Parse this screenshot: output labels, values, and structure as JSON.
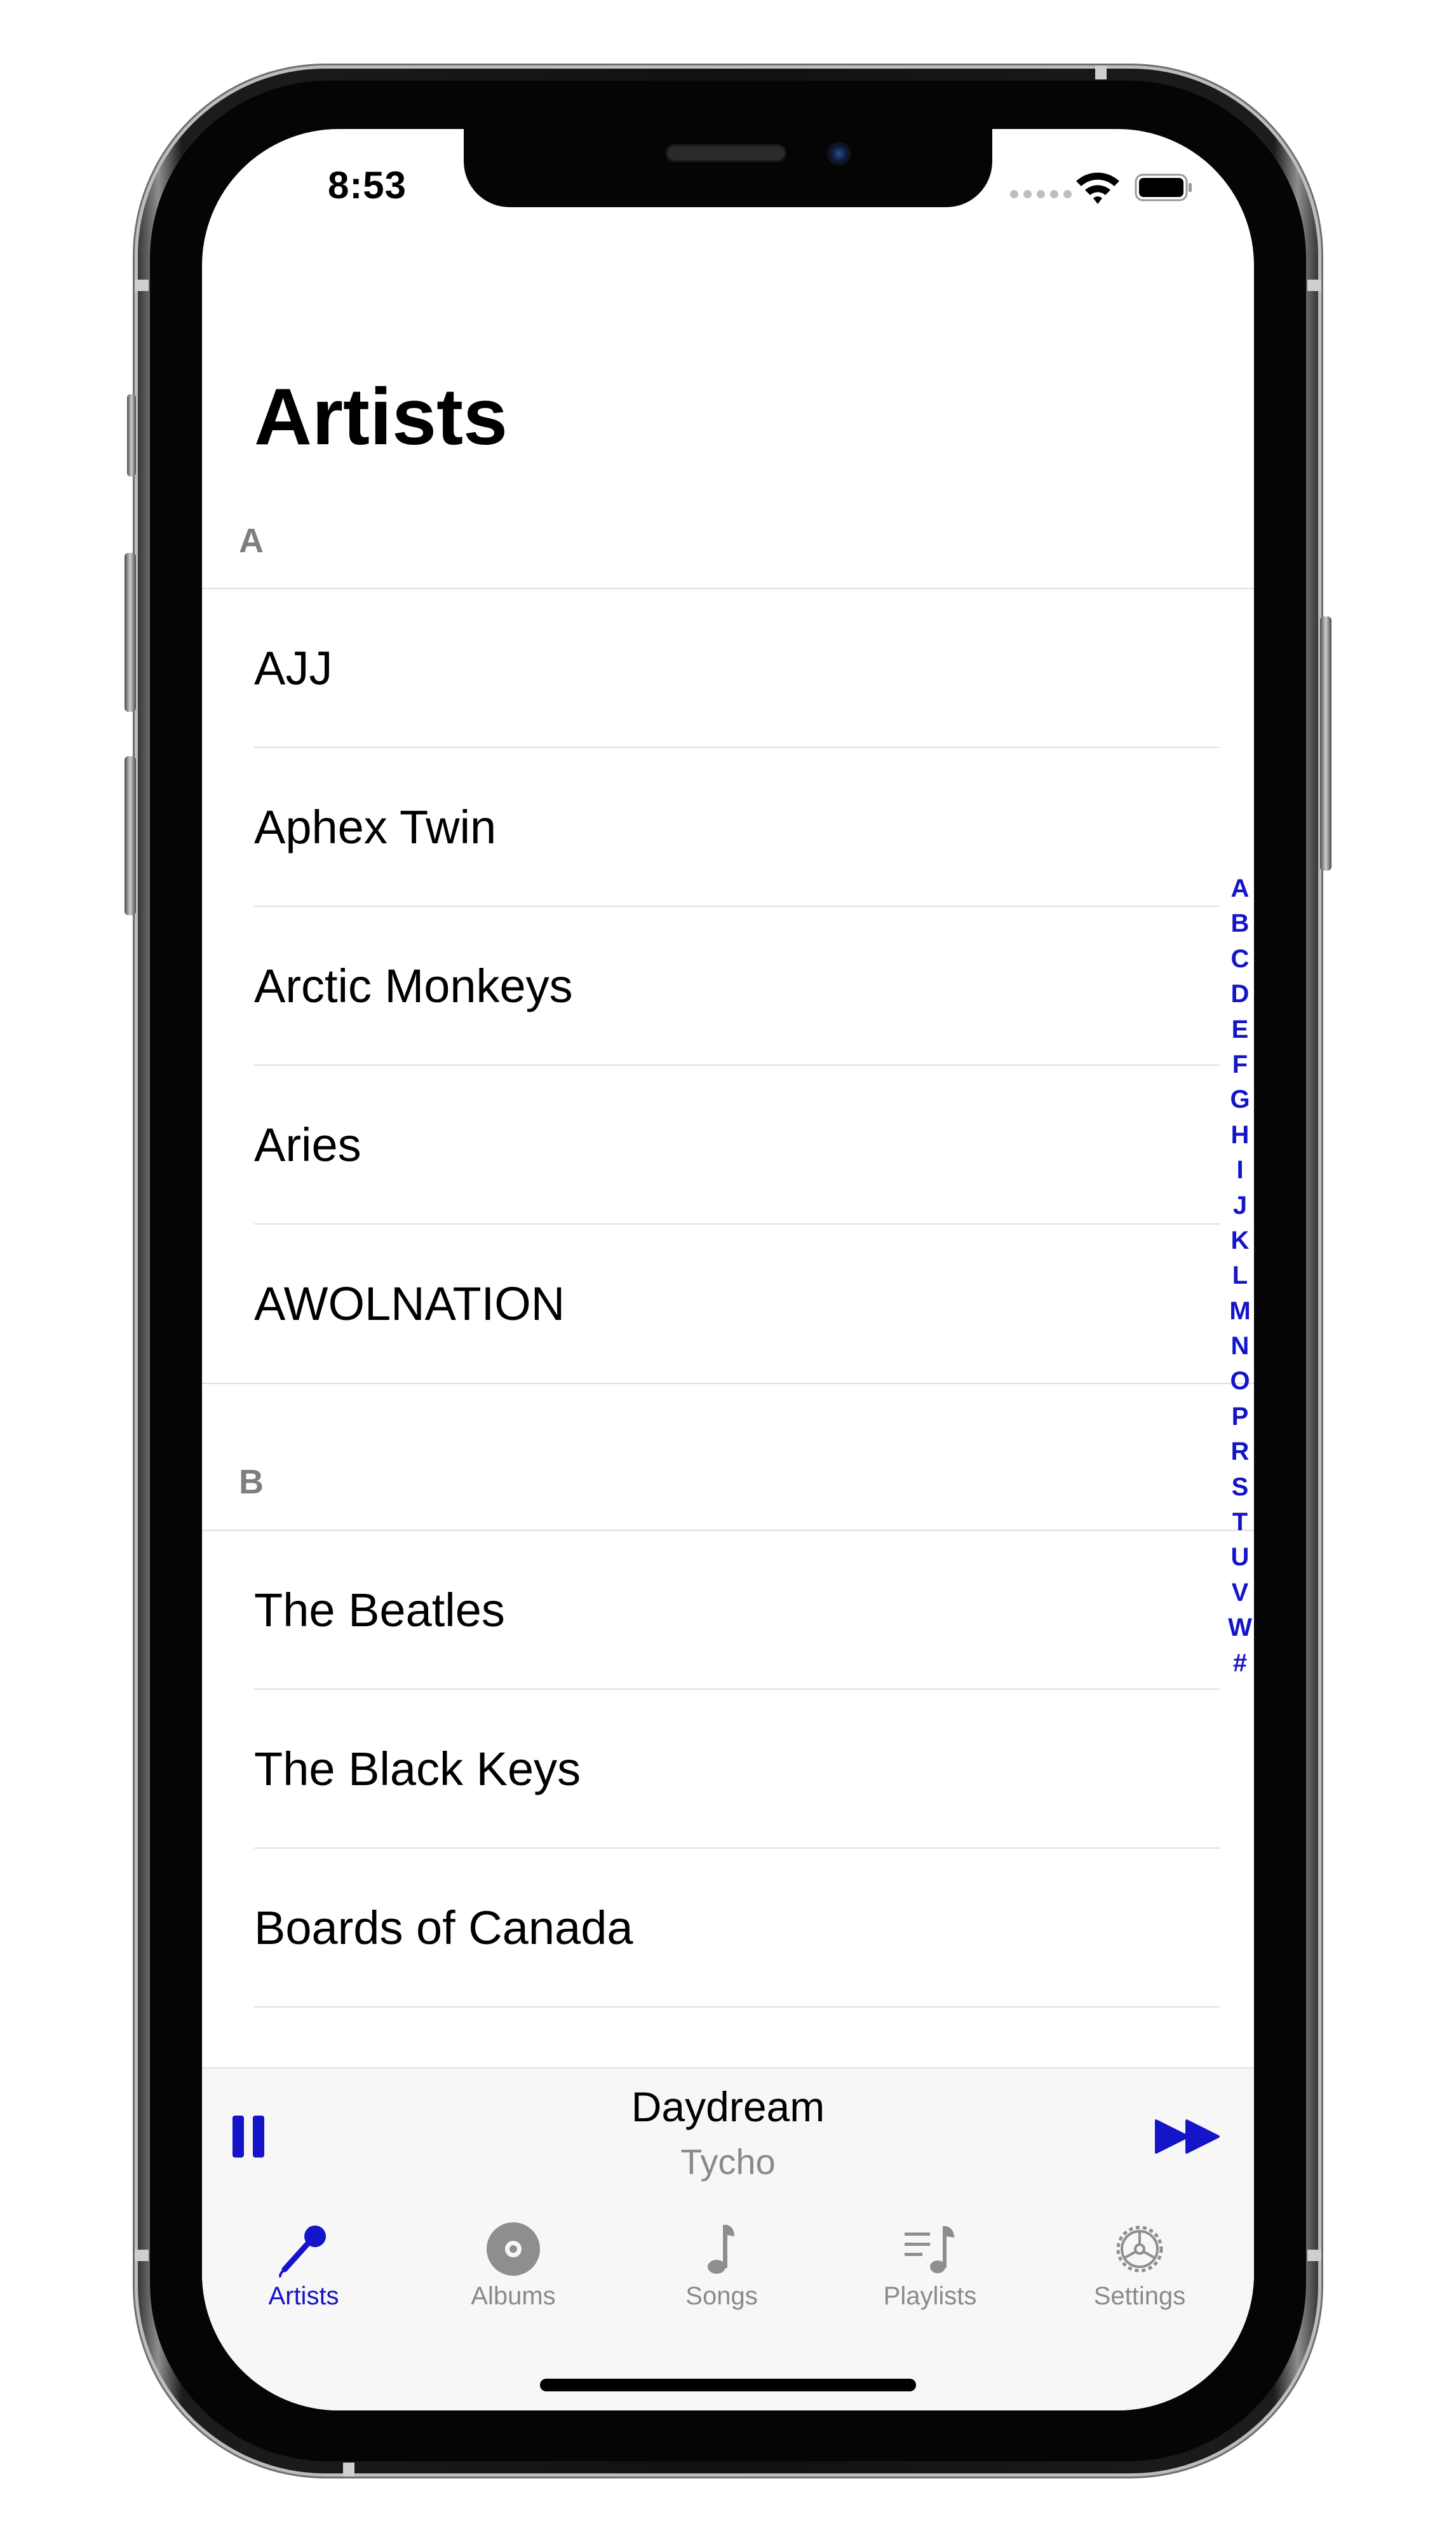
{
  "status_bar": {
    "time": "8:53"
  },
  "header": {
    "title": "Artists"
  },
  "sections": [
    {
      "letter": "A",
      "artists": [
        "AJJ",
        "Aphex Twin",
        "Arctic Monkeys",
        "Aries",
        "AWOLNATION"
      ]
    },
    {
      "letter": "B",
      "artists": [
        "The Beatles",
        "The Black Keys",
        "Boards of Canada"
      ]
    }
  ],
  "section_index": [
    "A",
    "B",
    "C",
    "D",
    "E",
    "F",
    "G",
    "H",
    "I",
    "J",
    "K",
    "L",
    "M",
    "N",
    "O",
    "P",
    "R",
    "S",
    "T",
    "U",
    "V",
    "W",
    "#"
  ],
  "now_playing": {
    "title": "Daydream",
    "artist": "Tycho"
  },
  "tab_bar": {
    "tabs": [
      {
        "label": "Artists",
        "icon": "microphone-icon",
        "active": true
      },
      {
        "label": "Albums",
        "icon": "disc-icon",
        "active": false
      },
      {
        "label": "Songs",
        "icon": "music-note-icon",
        "active": false
      },
      {
        "label": "Playlists",
        "icon": "playlist-icon",
        "active": false
      },
      {
        "label": "Settings",
        "icon": "gear-icon",
        "active": false
      }
    ]
  },
  "colors": {
    "accent": "#1414C8",
    "secondary_text": "#8A8A8A",
    "section_header": "#7E7E7E",
    "separator": "#E0E0E0"
  }
}
